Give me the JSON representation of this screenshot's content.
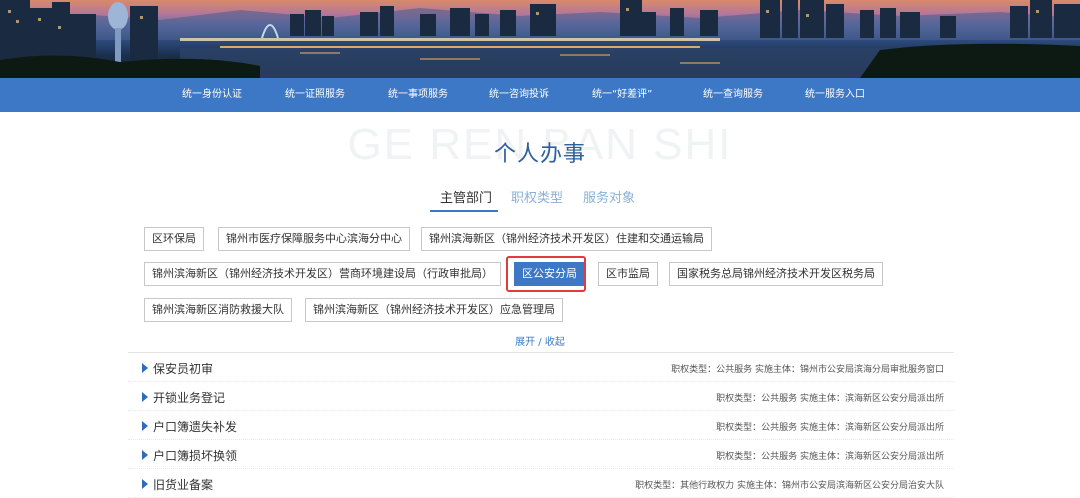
{
  "nav": {
    "items": [
      {
        "label": "统一身份认证"
      },
      {
        "label": "统一证照服务"
      },
      {
        "label": "统一事项服务"
      },
      {
        "label": "统一咨询投诉"
      },
      {
        "label": "统一“好差评”"
      },
      {
        "label": "统一查询服务"
      },
      {
        "label": "统一服务入口"
      }
    ]
  },
  "page": {
    "watermark": "GE REN BAN SHI",
    "title": "个人办事"
  },
  "tabs": [
    {
      "label": "主管部门",
      "active": true
    },
    {
      "label": "职权类型",
      "active": false
    },
    {
      "label": "服务对象",
      "active": false
    }
  ],
  "departments": [
    {
      "label": "区环保局"
    },
    {
      "label": "锦州市医疗保障服务中心滨海分中心"
    },
    {
      "label": "锦州滨海新区（锦州经济技术开发区）住建和交通运输局"
    },
    {
      "label": "锦州滨海新区（锦州经济技术开发区）营商环境建设局（行政审批局）"
    },
    {
      "label": "区公安分局",
      "selected": true
    },
    {
      "label": "区市监局"
    },
    {
      "label": "国家税务总局锦州经济技术开发区税务局"
    },
    {
      "label": "锦州滨海新区消防救援大队"
    },
    {
      "label": "锦州滨海新区（锦州经济技术开发区）应急管理局"
    }
  ],
  "toggle": {
    "label": "展开 / 收起"
  },
  "items": [
    {
      "name": "保安员初审",
      "meta": "职权类型：公共服务 实施主体：锦州市公安局滨海分局审批服务窗口"
    },
    {
      "name": "开锁业务登记",
      "meta": "职权类型：公共服务 实施主体：滨海新区公安分局派出所"
    },
    {
      "name": "户口簿遗失补发",
      "meta": "职权类型：公共服务 实施主体：滨海新区公安分局派出所"
    },
    {
      "name": "户口簿损坏换领",
      "meta": "职权类型：公共服务 实施主体：滨海新区公安分局派出所"
    },
    {
      "name": "旧货业备案",
      "meta": "职权类型：其他行政权力 实施主体：锦州市公安局滨海新区公安分局治安大队"
    }
  ],
  "colors": {
    "accent": "#3d78c6",
    "title": "#2f5f9d",
    "highlight": "#e23b3b"
  }
}
